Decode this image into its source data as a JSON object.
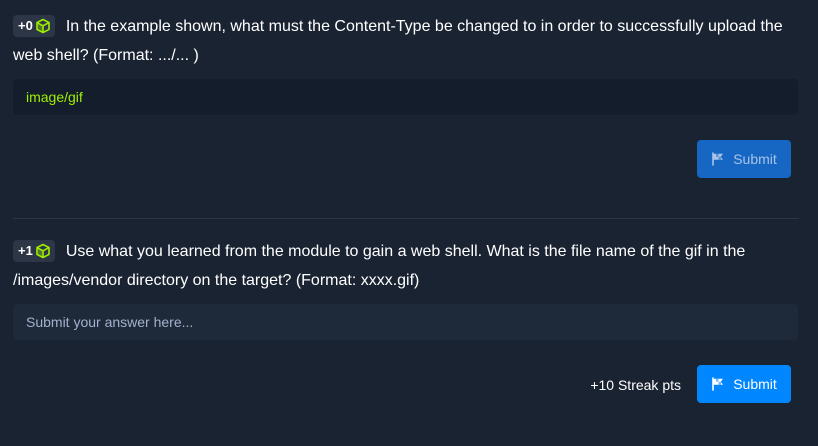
{
  "questions": [
    {
      "points": "+0",
      "text": "In the example shown, what must the Content-Type be changed to in order to successfully upload the web shell? (Format: .../... )",
      "answer_value": "image/gif",
      "submit_label": "Submit",
      "submit_state": "disabled"
    },
    {
      "points": "+1",
      "text": "Use what you learned from the module to gain a web shell. What is the file name of the gif in the /images/vendor directory on the target? (Format: xxxx.gif)",
      "answer_value": "",
      "answer_placeholder": "Submit your answer here...",
      "streak_text": "+10 Streak pts",
      "submit_label": "Submit",
      "submit_state": "active"
    }
  ],
  "icons": {
    "points": "cube-icon",
    "submit": "flag-icon"
  },
  "colors": {
    "background": "#1a2332",
    "answer_bg": "#141d2b",
    "answer_correct": "#9fef00",
    "cube_green": "#9fef00",
    "submit_active": "#0086ff",
    "submit_disabled": "#1666c3",
    "badge_bg": "#2c3646"
  }
}
